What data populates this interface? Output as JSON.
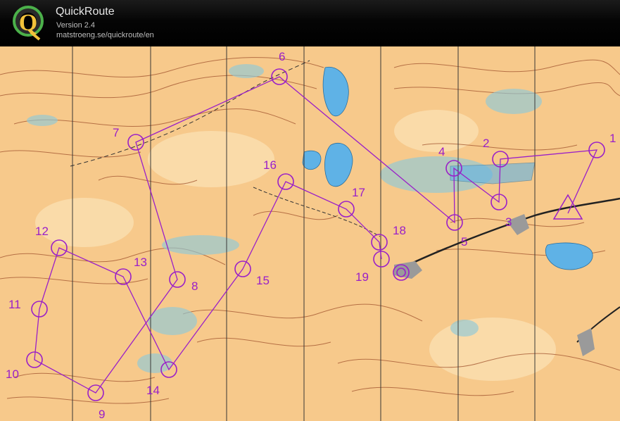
{
  "app": {
    "title": "QuickRoute",
    "version": "Version 2.4",
    "url": "matstroeng.se/quickroute/en"
  },
  "map": {
    "course_color": "#9a1fc8",
    "terrain_color": "#f7c98b",
    "water_color": "#5fb2e6",
    "contour_color": "#a0522d",
    "controls": [
      "1",
      "2",
      "3",
      "4",
      "5",
      "6",
      "7",
      "8",
      "9",
      "10",
      "11",
      "12",
      "13",
      "14",
      "15",
      "16",
      "17",
      "18",
      "19"
    ]
  }
}
